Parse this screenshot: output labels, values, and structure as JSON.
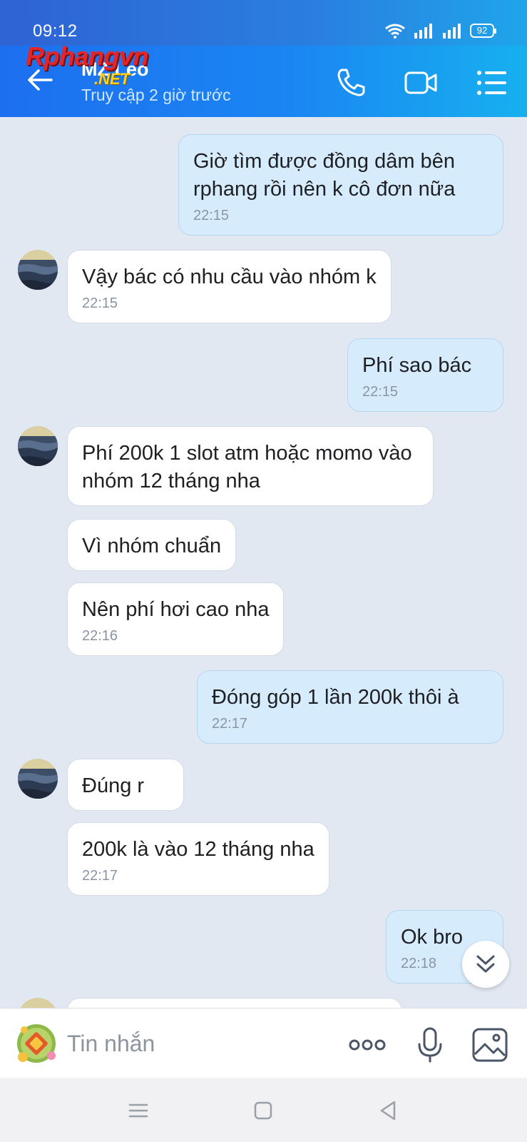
{
  "status_bar": {
    "time": "09:12",
    "battery": "92"
  },
  "header": {
    "contact_name": "MZ Leo",
    "contact_status": "Truy cập 2 giờ trước",
    "watermark_main": "Rphangvn",
    "watermark_sub": ".NET",
    "icons": [
      "back-arrow-icon",
      "phone-icon",
      "video-call-icon",
      "menu-list-icon"
    ]
  },
  "messages": [
    {
      "dir": "out",
      "text": "Giờ tìm được đồng dâm bên rphang rồi nên k cô đơn nữa",
      "time": "22:15"
    },
    {
      "dir": "in",
      "text": "Vậy bác có nhu cầu vào nhóm k",
      "time": "22:15"
    },
    {
      "dir": "out",
      "text": "Phí sao bác",
      "time": "22:15"
    },
    {
      "dir": "in",
      "text": "Phí 200k 1 slot atm hoặc momo vào nhóm 12 tháng nha",
      "time": ""
    },
    {
      "dir": "in",
      "text": "Vì nhóm chuẩn",
      "time": ""
    },
    {
      "dir": "in",
      "text": "Nên phí hơi cao nha",
      "time": "22:16"
    },
    {
      "dir": "out",
      "text": "Đóng góp 1 lần 200k thôi à",
      "time": "22:17"
    },
    {
      "dir": "in",
      "text": "Đúng r",
      "time": ""
    },
    {
      "dir": "in",
      "text": "200k là vào 12 tháng nha",
      "time": "22:17"
    },
    {
      "dir": "out",
      "text": "Ok bro",
      "time": "22:18"
    }
  ],
  "input_bar": {
    "placeholder": "Tin nhắn",
    "icons": [
      "sticker-icon",
      "more-icon",
      "microphone-icon",
      "image-icon"
    ]
  },
  "colors": {
    "header_start": "#1d6ff0",
    "header_end": "#17b0ef",
    "outgoing_bubble": "#d6ecfd",
    "incoming_bubble": "#ffffff",
    "chat_background": "#e2e8f1"
  }
}
